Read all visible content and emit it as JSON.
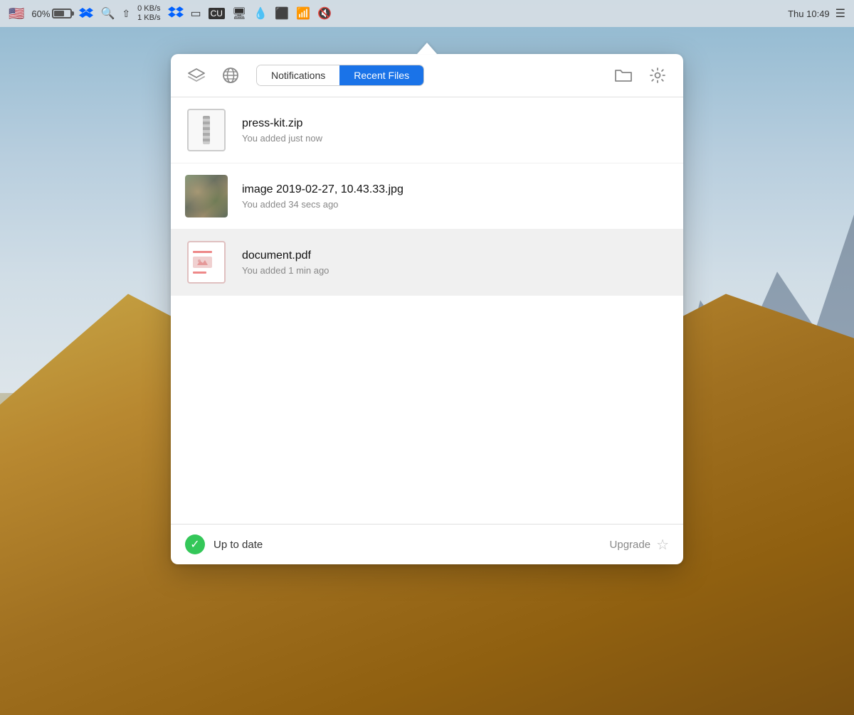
{
  "menubar": {
    "battery_percent": "60%",
    "network_upload": "0 KB/s",
    "network_download": "1 KB/s",
    "clock": "Thu 10:49"
  },
  "tabs": {
    "notifications_label": "Notifications",
    "recent_files_label": "Recent Files",
    "active": "recent_files"
  },
  "files": [
    {
      "name": "press-kit.zip",
      "time": "You added just now",
      "type": "zip",
      "highlighted": false
    },
    {
      "name": "image 2019-02-27, 10.43.33.jpg",
      "time": "You added 34 secs ago",
      "type": "image",
      "highlighted": false
    },
    {
      "name": "document.pdf",
      "time": "You added 1 min ago",
      "type": "pdf",
      "highlighted": true
    }
  ],
  "footer": {
    "status_text": "Up to date",
    "upgrade_text": "Upgrade"
  }
}
